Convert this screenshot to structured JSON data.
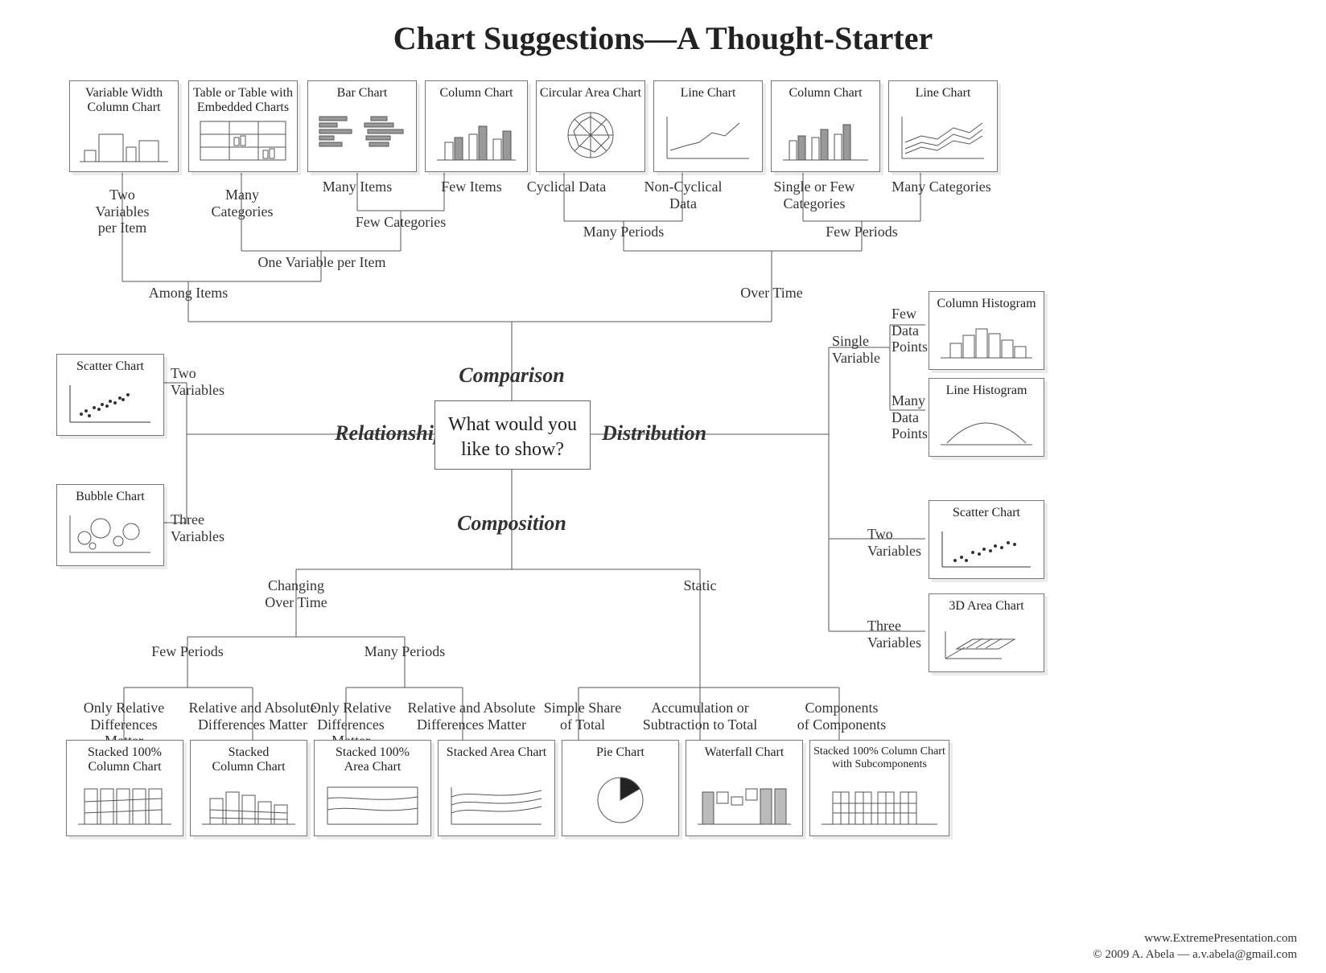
{
  "title": "Chart Suggestions—A Thought-Starter",
  "center": "What would you\nlike to show?",
  "branches": {
    "comparison": "Comparison",
    "relationship": "Relationship",
    "composition": "Composition",
    "distribution": "Distribution"
  },
  "labels": {
    "two_var_per_item": "Two Variables\nper Item",
    "many_categories": "Many\nCategories",
    "many_items": "Many Items",
    "few_items": "Few Items",
    "few_categories": "Few Categories",
    "one_var_per_item": "One Variable per Item",
    "among_items": "Among Items",
    "cyclical": "Cyclical Data",
    "non_cyclical": "Non-Cyclical Data",
    "single_or_few_cat": "Single or Few Categories",
    "many_categories2": "Many Categories",
    "many_periods": "Many Periods",
    "few_periods_top": "Few Periods",
    "over_time": "Over Time",
    "two_variables": "Two\nVariables",
    "three_variables": "Three\nVariables",
    "single_variable": "Single\nVariable",
    "few_data_points": "Few\nData\nPoints",
    "many_data_points": "Many\nData\nPoints",
    "two_variables2": "Two\nVariables",
    "three_variables2": "Three\nVariables",
    "changing_over_time": "Changing\nOver Time",
    "static": "Static",
    "few_periods": "Few Periods",
    "many_periods2": "Many Periods",
    "only_rel_diff": "Only Relative\nDifferences Matter",
    "rel_abs_diff": "Relative and Absolute\nDifferences Matter",
    "only_rel_diff2": "Only Relative\nDifferences Matter",
    "rel_abs_diff2": "Relative and Absolute\nDifferences Matter",
    "simple_share": "Simple Share\nof Total",
    "accum": "Accumulation or\nSubtraction to Total",
    "comp_of_comp": "Components\nof Components"
  },
  "cards": {
    "var_width_col": {
      "t": "Variable Width\nColumn Chart"
    },
    "table_embedded": {
      "t": "Table or Table with\nEmbedded Charts"
    },
    "bar_chart": {
      "t": "Bar Chart"
    },
    "column_chart_top": {
      "t": "Column Chart"
    },
    "circular_area": {
      "t": "Circular Area Chart"
    },
    "line_chart_top": {
      "t": "Line Chart"
    },
    "column_chart_top2": {
      "t": "Column Chart"
    },
    "line_chart_top2": {
      "t": "Line Chart"
    },
    "scatter_chart_left": {
      "t": "Scatter Chart"
    },
    "bubble_chart": {
      "t": "Bubble Chart"
    },
    "column_histogram": {
      "t": "Column Histogram"
    },
    "line_histogram": {
      "t": "Line Histogram"
    },
    "scatter_chart_right": {
      "t": "Scatter Chart"
    },
    "area3d_chart": {
      "t": "3D Area Chart"
    },
    "stacked100_col": {
      "t": "Stacked 100%\nColumn Chart"
    },
    "stacked_col": {
      "t": "Stacked\nColumn Chart"
    },
    "stacked100_area": {
      "t": "Stacked 100%\nArea Chart"
    },
    "stacked_area": {
      "t": "Stacked Area Chart"
    },
    "pie_chart": {
      "t": "Pie Chart"
    },
    "waterfall_chart": {
      "t": "Waterfall Chart"
    },
    "stacked100_sub": {
      "t": "Stacked 100% Column Chart\nwith Subcomponents"
    }
  },
  "credit": {
    "url": "www.ExtremePresentation.com",
    "copy": "© 2009  A. Abela — a.v.abela@gmail.com"
  }
}
